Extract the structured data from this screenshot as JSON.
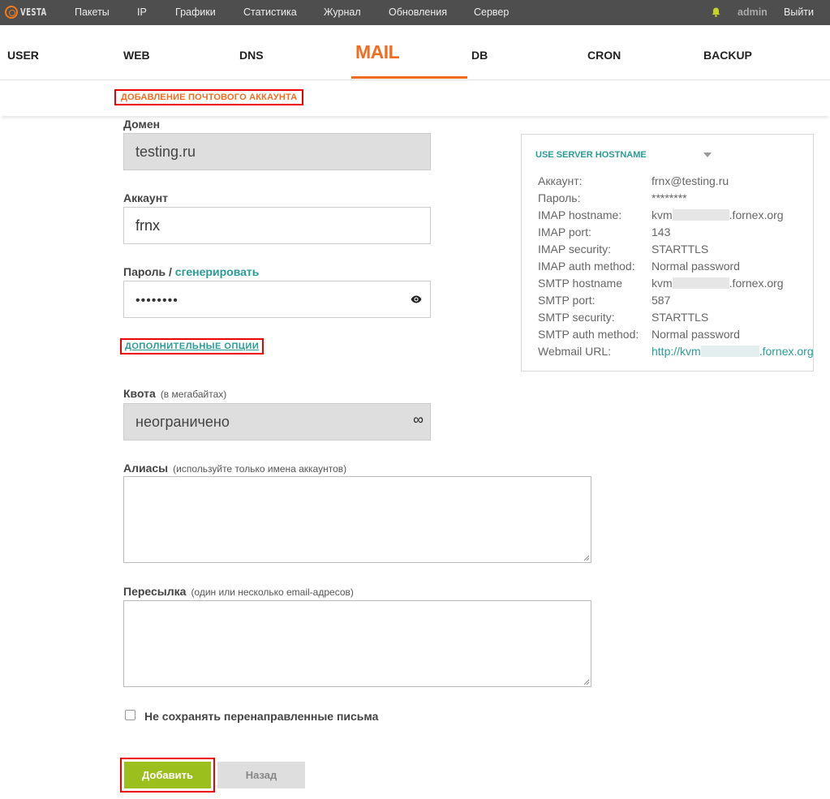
{
  "topbar": {
    "logo": "VESTA",
    "nav": [
      "Пакеты",
      "IP",
      "Графики",
      "Статистика",
      "Журнал",
      "Обновления",
      "Сервер"
    ],
    "user": "admin",
    "logout": "Выйти"
  },
  "tabs": {
    "items": [
      "USER",
      "WEB",
      "DNS",
      "MAIL",
      "DB",
      "CRON",
      "BACKUP"
    ],
    "active": "MAIL"
  },
  "subheader": {
    "title": "ДОБАВЛЕНИЕ ПОЧТОВОГО АККАУНТА"
  },
  "form": {
    "domain_label": "Домен",
    "domain_value": "testing.ru",
    "account_label": "Аккаунт",
    "account_value": "frnx",
    "password_label": "Пароль /",
    "generate_label": "сгенерировать",
    "password_value": "••••••••",
    "advanced_label": "ДОПОЛНИТЕЛЬНЫЕ ОПЦИИ",
    "quota_label": "Квота",
    "quota_hint": "(в мегабайтах)",
    "quota_value": "неограничено",
    "quota_symbol": "∞",
    "aliases_label": "Алиасы",
    "aliases_hint": "(используйте только имена аккаунтов)",
    "forward_label": "Пересылка",
    "forward_hint": "(один или несколько email-адресов)",
    "checkbox_label": "Не сохранять перенаправленные письма",
    "submit_label": "Добавить",
    "back_label": "Назад"
  },
  "panel": {
    "title": "USE SERVER HOSTNAME",
    "rows": [
      {
        "label": "Аккаунт:",
        "value": "frnx@testing.ru"
      },
      {
        "label": "Пароль:",
        "value": "********"
      },
      {
        "label": "IMAP hostname:",
        "prefix": "kvm",
        "suffix": ".fornex.org"
      },
      {
        "label": "IMAP port:",
        "value": "143"
      },
      {
        "label": "IMAP security:",
        "value": "STARTTLS"
      },
      {
        "label": "IMAP auth method:",
        "value": "Normal password"
      },
      {
        "label": "SMTP hostname",
        "prefix": "kvm",
        "suffix": ".fornex.org"
      },
      {
        "label": "SMTP port:",
        "value": "587"
      },
      {
        "label": "SMTP security:",
        "value": "STARTTLS"
      },
      {
        "label": "SMTP auth method:",
        "value": "Normal password"
      },
      {
        "label": "Webmail URL:",
        "prefix": "http://kvm",
        "suffix": ".fornex.org/"
      }
    ]
  },
  "colors": {
    "accent": "#f26d21",
    "link": "#2a9c96",
    "submit": "#9bbf1c",
    "topbar": "#4e4e4e"
  }
}
